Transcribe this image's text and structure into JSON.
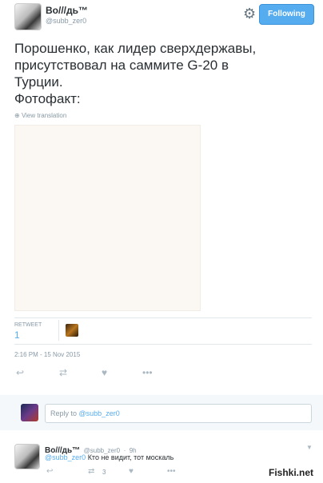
{
  "header": {
    "name": "Во///дь™",
    "handle": "@subb_zer0",
    "follow_label": "Following",
    "settings_icon": "gear-icon"
  },
  "tweet": {
    "text": "Порошенко, как лидер сверхдержавы,\nприсутствовал на саммите G-20 в\nТурции.\nФотофакт:",
    "translate_label": "View translation",
    "stats": {
      "retweet_label": "RETWEET",
      "retweet_count": "1"
    },
    "timestamp": "2:16 PM - 15 Nov 2015"
  },
  "actions": {
    "reply_icon": "reply-icon",
    "retweet_icon": "retweet-icon",
    "like_icon": "heart-icon",
    "more_icon": "more-icon"
  },
  "reply_box": {
    "prefix": "Reply to ",
    "mention": "@subb_zer0"
  },
  "reply_tweet": {
    "name": "Во///дь™",
    "handle": "@subb_zer0",
    "time": "9h",
    "mention": "@subb_zer0",
    "text": "Кто не видит, тот москаль",
    "retweet_count": "3"
  },
  "watermark": "Fishki.net"
}
